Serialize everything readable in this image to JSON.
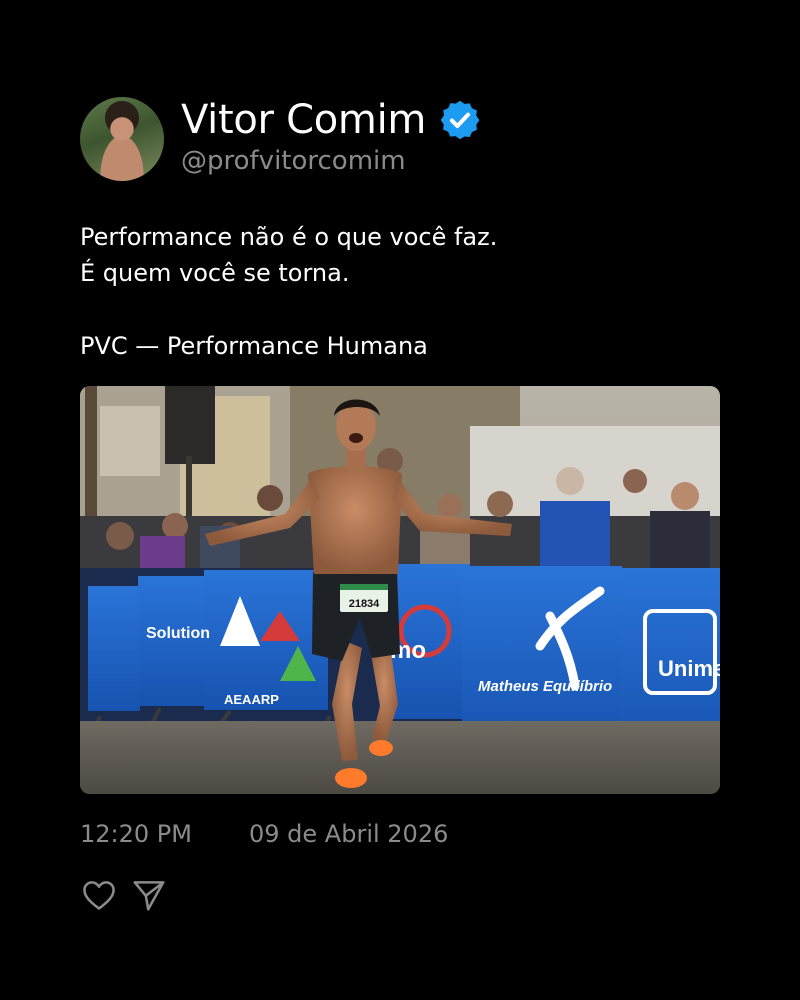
{
  "author": {
    "display_name": "Vitor Comim",
    "handle": "@profvitorcomim",
    "verified": true,
    "verified_icon": "verified-badge-icon"
  },
  "post": {
    "lines": [
      "Performance não é o que você faz.",
      "É quem você se torna."
    ],
    "signature": "PVC — Performance Humana"
  },
  "photo": {
    "bib_number": "21834",
    "banners": [
      "Solution",
      "AEAARP",
      "mo",
      "Matheus Equilíbrio",
      "Unime"
    ]
  },
  "meta": {
    "time": "12:20 PM",
    "date": "09 de Abril 2026"
  },
  "actions": {
    "like_icon": "heart-icon",
    "share_icon": "send-icon"
  },
  "colors": {
    "background": "#000000",
    "primary_text": "#ffffff",
    "secondary_text": "#8b8b8b",
    "verified": "#1d9bf0",
    "banner_blue": "#1f63c9"
  }
}
